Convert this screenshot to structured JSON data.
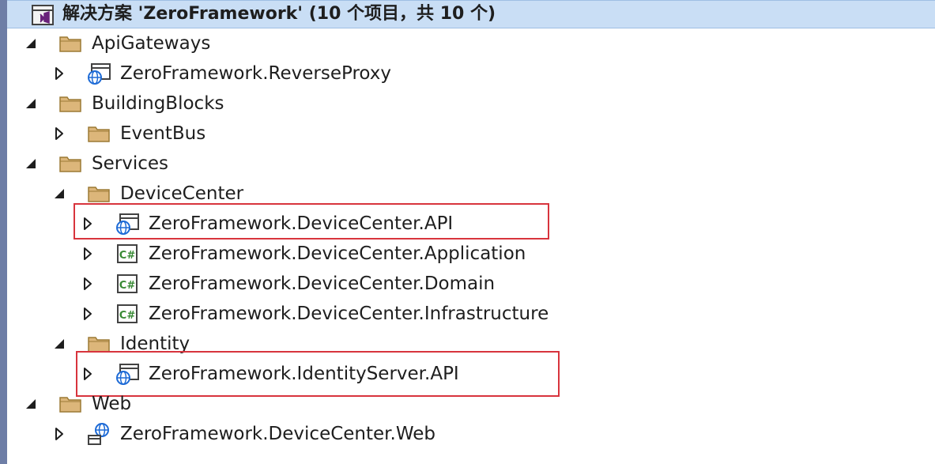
{
  "solution": {
    "title": "解决方案 'ZeroFramework' (10 个项目，共 10 个)",
    "icon": "visual-studio-solution-icon"
  },
  "tree": [
    {
      "label": "ApiGateways",
      "type": "folder",
      "depth": 0,
      "expanded": true
    },
    {
      "label": "ZeroFramework.ReverseProxy",
      "type": "web-project",
      "depth": 1,
      "expanded": false
    },
    {
      "label": "BuildingBlocks",
      "type": "folder",
      "depth": 0,
      "expanded": true
    },
    {
      "label": "EventBus",
      "type": "folder",
      "depth": 1,
      "expanded": false
    },
    {
      "label": "Services",
      "type": "folder",
      "depth": 0,
      "expanded": true
    },
    {
      "label": "DeviceCenter",
      "type": "folder",
      "depth": 1,
      "expanded": true
    },
    {
      "label": "ZeroFramework.DeviceCenter.API",
      "type": "web-project",
      "depth": 2,
      "expanded": false,
      "highlighted": true
    },
    {
      "label": "ZeroFramework.DeviceCenter.Application",
      "type": "csharp-project",
      "depth": 2,
      "expanded": false
    },
    {
      "label": "ZeroFramework.DeviceCenter.Domain",
      "type": "csharp-project",
      "depth": 2,
      "expanded": false
    },
    {
      "label": "ZeroFramework.DeviceCenter.Infrastructure",
      "type": "csharp-project",
      "depth": 2,
      "expanded": false
    },
    {
      "label": "Identity",
      "type": "folder",
      "depth": 1,
      "expanded": true
    },
    {
      "label": "ZeroFramework.IdentityServer.API",
      "type": "web-project",
      "depth": 2,
      "expanded": false,
      "highlighted": true
    },
    {
      "label": "Web",
      "type": "folder",
      "depth": 0,
      "expanded": true
    },
    {
      "label": "ZeroFramework.DeviceCenter.Web",
      "type": "web-site-project",
      "depth": 1,
      "expanded": false
    }
  ],
  "colors": {
    "header_bg": "#c9def5",
    "highlight_border": "#d8343d",
    "folder": "#dcb67a",
    "web_globe": "#1e6bd6",
    "csharp": "#388a34"
  }
}
